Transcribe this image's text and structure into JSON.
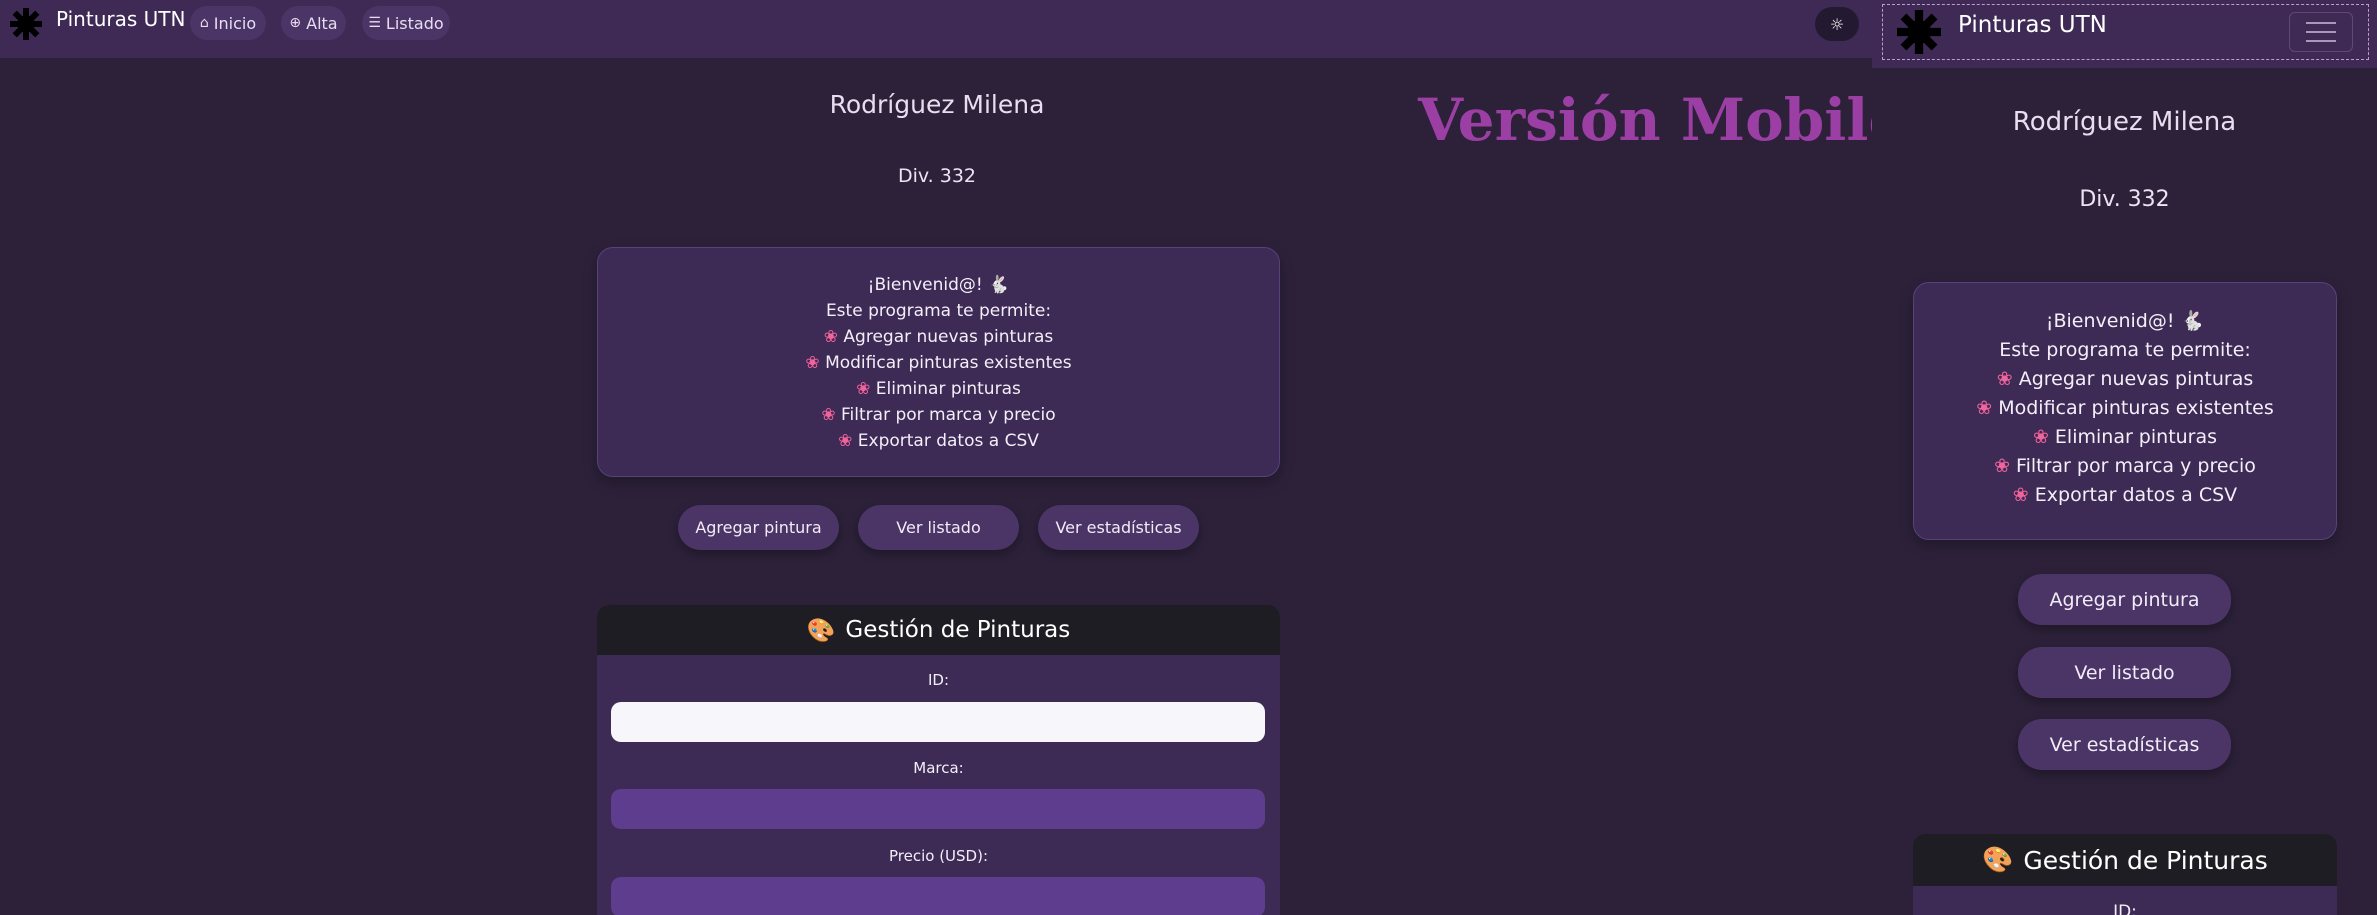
{
  "navbar": {
    "brand": "Pinturas UTN",
    "links": [
      {
        "label": "Inicio",
        "icon": "home-icon"
      },
      {
        "label": "Alta",
        "icon": "plus-circle-icon"
      },
      {
        "label": "Listado",
        "icon": "list-icon"
      }
    ],
    "theme_toggle_icon": "sun-icon"
  },
  "student": {
    "name": "Rodríguez Milena",
    "division": "Div. 332"
  },
  "welcome": {
    "title": "¡Bienvenid@! 🐇",
    "intro": "Este programa te permite:",
    "items": [
      "Agregar nuevas pinturas",
      "Modificar pinturas existentes",
      "Eliminar pinturas",
      "Filtrar por marca y precio",
      "Exportar datos a CSV"
    ],
    "bullet_icon": "flower-icon"
  },
  "actions": {
    "add": "Agregar pintura",
    "list": "Ver listado",
    "stats": "Ver estadísticas"
  },
  "form": {
    "title": "Gestión de Pinturas",
    "title_icon": "palette-icon",
    "id_label": "ID:",
    "brand_label": "Marca:",
    "price_label": "Precio (USD):",
    "id_value": "",
    "brand_value": "",
    "price_value": ""
  },
  "mobile": {
    "annotation": "Versión Mobile:",
    "brand": "Pinturas UTN",
    "id_label": "ID:"
  },
  "colors": {
    "background": "#2c2139",
    "navbar": "#3f2a56",
    "card": "#3d2b55",
    "button": "#4b3466",
    "field": "#5e3c8e",
    "id_field": "#f7f6fb",
    "form_header": "#1f1d24",
    "annotation": "#9b3fa4",
    "flower": "#f1639b"
  }
}
